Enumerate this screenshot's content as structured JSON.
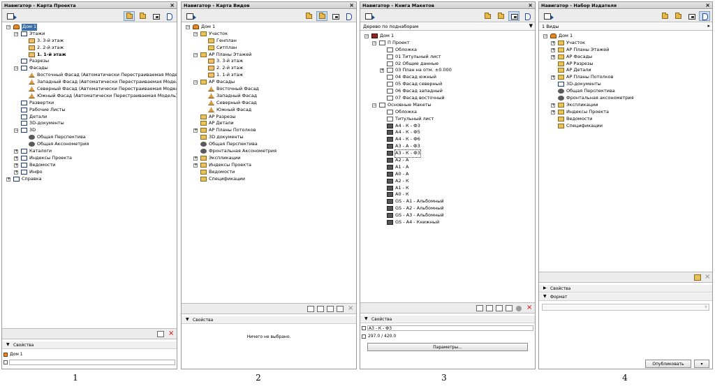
{
  "panels": [
    {
      "title": "Навигатор - Карта Проекта",
      "tree": [
        {
          "d": 0,
          "icon": "house",
          "text": "Дом 1",
          "exp": "-",
          "sel": true
        },
        {
          "d": 1,
          "icon": "view",
          "text": "Этажи",
          "exp": "-"
        },
        {
          "d": 2,
          "icon": "storey",
          "text": "3. 3-й этаж"
        },
        {
          "d": 2,
          "icon": "storey",
          "text": "2. 2-й этаж"
        },
        {
          "d": 2,
          "icon": "storey",
          "text": "1. 1-й этаж",
          "bold": true
        },
        {
          "d": 1,
          "icon": "view",
          "text": "Разрезы"
        },
        {
          "d": 1,
          "icon": "view",
          "text": "Фасады",
          "exp": "-"
        },
        {
          "d": 2,
          "icon": "elev",
          "text": "Восточный Фасад (Автоматически Перестраиваемая Модель)"
        },
        {
          "d": 2,
          "icon": "elev",
          "text": "Западный Фасад (Автоматически Перестраиваемая Модель)"
        },
        {
          "d": 2,
          "icon": "elev",
          "text": "Северный Фасад (Автоматически Перестраиваемая Модель)"
        },
        {
          "d": 2,
          "icon": "elev",
          "text": "Южный Фасад (Автоматически Перестраиваемая Модель)"
        },
        {
          "d": 1,
          "icon": "view",
          "text": "Развертки"
        },
        {
          "d": 1,
          "icon": "view",
          "text": "Рабочие Листы"
        },
        {
          "d": 1,
          "icon": "view",
          "text": "Детали"
        },
        {
          "d": 1,
          "icon": "view",
          "text": "3D-документы"
        },
        {
          "d": 1,
          "icon": "view",
          "text": "3D",
          "exp": "-"
        },
        {
          "d": 2,
          "icon": "3d",
          "text": "Общая Перспектива"
        },
        {
          "d": 2,
          "icon": "3d",
          "text": "Общая Аксонометрия"
        },
        {
          "d": 1,
          "icon": "view",
          "text": "Каталоги",
          "exp": "+"
        },
        {
          "d": 1,
          "icon": "view",
          "text": "Индексы Проекта",
          "exp": "+"
        },
        {
          "d": 1,
          "icon": "view",
          "text": "Ведомости",
          "exp": "+"
        },
        {
          "d": 1,
          "icon": "view",
          "text": "Инфо",
          "exp": "+"
        },
        {
          "d": 0,
          "icon": "view",
          "text": "Справка",
          "exp": "+"
        }
      ],
      "properties_label": "Свойства",
      "prop_value": "Дом 1"
    },
    {
      "title": "Навигатор - Карта Видов",
      "tree": [
        {
          "d": 0,
          "icon": "house",
          "text": "Дом 1",
          "exp": "-"
        },
        {
          "d": 1,
          "icon": "folder",
          "text": "Участок",
          "exp": "-"
        },
        {
          "d": 2,
          "icon": "folder",
          "text": "Генплан"
        },
        {
          "d": 2,
          "icon": "folder",
          "text": "Ситплан"
        },
        {
          "d": 1,
          "icon": "folder",
          "text": "АР Планы Этажей",
          "exp": "-"
        },
        {
          "d": 2,
          "icon": "storey",
          "text": "3. 3-й этаж"
        },
        {
          "d": 2,
          "icon": "storey",
          "text": "2. 2-й этаж"
        },
        {
          "d": 2,
          "icon": "storey",
          "text": "1. 1-й этаж"
        },
        {
          "d": 1,
          "icon": "folder",
          "text": "АР Фасады",
          "exp": "-"
        },
        {
          "d": 2,
          "icon": "elev",
          "text": "Восточный Фасад"
        },
        {
          "d": 2,
          "icon": "elev",
          "text": "Западный Фасад"
        },
        {
          "d": 2,
          "icon": "elev",
          "text": "Северный Фасад"
        },
        {
          "d": 2,
          "icon": "elev",
          "text": "Южный Фасад"
        },
        {
          "d": 1,
          "icon": "folder",
          "text": "АР Разрезы"
        },
        {
          "d": 1,
          "icon": "folder",
          "text": "АР Детали"
        },
        {
          "d": 1,
          "icon": "folder",
          "text": "АР Планы Потолков",
          "exp": "+"
        },
        {
          "d": 1,
          "icon": "folder",
          "text": "3D документы"
        },
        {
          "d": 1,
          "icon": "3d",
          "text": "Общая Перспектива"
        },
        {
          "d": 1,
          "icon": "3d",
          "text": "Фронтальная Аксонометрия"
        },
        {
          "d": 1,
          "icon": "folder",
          "text": "Экспликации",
          "exp": "+"
        },
        {
          "d": 1,
          "icon": "folder",
          "text": "Индексы Проекта",
          "exp": "+"
        },
        {
          "d": 1,
          "icon": "folder",
          "text": "Ведомости"
        },
        {
          "d": 1,
          "icon": "folder",
          "text": "Спецификации"
        }
      ],
      "properties_label": "Свойства",
      "empty_msg": "Ничего не выбрано."
    },
    {
      "title": "Навигатор - Книга Макетов",
      "subrow": "Дерево по поднаборам",
      "tree": [
        {
          "d": 0,
          "icon": "book",
          "text": "Дом 1",
          "exp": "-"
        },
        {
          "d": 1,
          "icon": "sheet",
          "text": "П Проект",
          "exp": "-"
        },
        {
          "d": 2,
          "icon": "sheet",
          "text": "Обложка"
        },
        {
          "d": 2,
          "icon": "sheet",
          "text": "01 Титульный лист"
        },
        {
          "d": 2,
          "icon": "sheet",
          "text": "02 Общие данные"
        },
        {
          "d": 2,
          "icon": "sheet",
          "text": "03 План на отм. ±0.000",
          "exp": "+"
        },
        {
          "d": 2,
          "icon": "sheet",
          "text": "04 Фасад южный"
        },
        {
          "d": 2,
          "icon": "sheet",
          "text": "05 Фасад северный"
        },
        {
          "d": 2,
          "icon": "sheet",
          "text": "06 Фасад западный"
        },
        {
          "d": 2,
          "icon": "sheet",
          "text": "07 Фасад восточный"
        },
        {
          "d": 1,
          "icon": "sheet",
          "text": "Основные Макеты",
          "exp": "-"
        },
        {
          "d": 2,
          "icon": "sheet",
          "text": "Обложка"
        },
        {
          "d": 2,
          "icon": "sheet",
          "text": "Титульный лист"
        },
        {
          "d": 2,
          "icon": "sheetd",
          "text": "А4 - К - Ф3"
        },
        {
          "d": 2,
          "icon": "sheetd",
          "text": "А4 - К - Ф5"
        },
        {
          "d": 2,
          "icon": "sheetd",
          "text": "А4 - К - Ф6"
        },
        {
          "d": 2,
          "icon": "sheetd",
          "text": "А3 - А - Ф3"
        },
        {
          "d": 2,
          "icon": "sheetd",
          "text": "А3 - К - Ф3",
          "outline": true
        },
        {
          "d": 2,
          "icon": "sheetd",
          "text": "А2 - А"
        },
        {
          "d": 2,
          "icon": "sheetd",
          "text": "А1 - А"
        },
        {
          "d": 2,
          "icon": "sheetd",
          "text": "А0 - А"
        },
        {
          "d": 2,
          "icon": "sheetd",
          "text": "А2 - К"
        },
        {
          "d": 2,
          "icon": "sheetd",
          "text": "А1 - К"
        },
        {
          "d": 2,
          "icon": "sheetd",
          "text": "А0 - К"
        },
        {
          "d": 2,
          "icon": "sheetd",
          "text": "GS - А1 - Альбомный"
        },
        {
          "d": 2,
          "icon": "sheetd",
          "text": "GS - А2 - Альбомный"
        },
        {
          "d": 2,
          "icon": "sheetd",
          "text": "GS - А3 - Альбомный"
        },
        {
          "d": 2,
          "icon": "sheetd",
          "text": "GS - А4 - Книжный"
        }
      ],
      "properties_label": "Свойства",
      "prop_name": "А3 - К - Ф3",
      "prop_size": "297.0 / 420.0",
      "params_button": "Параметры..."
    },
    {
      "title": "Навигатор - Набор Издателя",
      "subrow": "1 Виды",
      "tree": [
        {
          "d": 0,
          "icon": "house",
          "text": "Дом 1",
          "exp": "-"
        },
        {
          "d": 1,
          "icon": "folder",
          "text": "Участок",
          "exp": "+"
        },
        {
          "d": 1,
          "icon": "folder",
          "text": "АР Планы Этажей",
          "exp": "+"
        },
        {
          "d": 1,
          "icon": "folder",
          "text": "АР Фасады",
          "exp": "+"
        },
        {
          "d": 1,
          "icon": "folder",
          "text": "АР Разрезы"
        },
        {
          "d": 1,
          "icon": "folder",
          "text": "АР Детали"
        },
        {
          "d": 1,
          "icon": "folder",
          "text": "АР Планы Потолков",
          "exp": "+"
        },
        {
          "d": 1,
          "icon": "view",
          "text": "3D-документы"
        },
        {
          "d": 1,
          "icon": "3d",
          "text": "Общая Перспектива"
        },
        {
          "d": 1,
          "icon": "3d",
          "text": "Фронтальная аксонометрия"
        },
        {
          "d": 1,
          "icon": "folder",
          "text": "Экспликации",
          "exp": "+"
        },
        {
          "d": 1,
          "icon": "folder",
          "text": "Индексы Проекта",
          "exp": "+"
        },
        {
          "d": 1,
          "icon": "folder",
          "text": "Ведомости"
        },
        {
          "d": 1,
          "icon": "folder",
          "text": "Спецификации"
        }
      ],
      "properties_label": "Свойства",
      "format_label": "Формат",
      "publish_button": "Опубликовать"
    }
  ],
  "captions": [
    "1",
    "2",
    "3",
    "4"
  ],
  "close_glyph": "×",
  "colors": {
    "selection": "#3a6ea5",
    "active_tab": "#c9dcf2",
    "delete": "#cc0000"
  }
}
